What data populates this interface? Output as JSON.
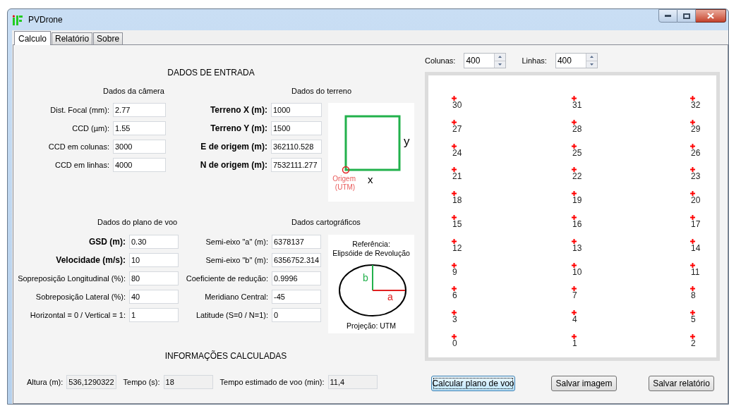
{
  "window": {
    "title": "PVDrone"
  },
  "tabs": [
    {
      "label": "Calculo",
      "selected": true
    },
    {
      "label": "Relatório",
      "selected": false
    },
    {
      "label": "Sobre",
      "selected": false
    }
  ],
  "input_section": {
    "heading": "DADOS DE ENTRADA",
    "camera": {
      "title": "Dados da câmera",
      "fields": [
        {
          "label": "Dist. Focal (mm):",
          "value": "2.77",
          "bold": false
        },
        {
          "label": "CCD (µm):",
          "value": "1.55",
          "bold": false
        },
        {
          "label": "CCD em colunas:",
          "value": "3000",
          "bold": false
        },
        {
          "label": "CCD em linhas:",
          "value": "4000",
          "bold": false
        }
      ]
    },
    "terrain": {
      "title": "Dados do terreno",
      "fields": [
        {
          "label": "Terreno X (m):",
          "value": "1000",
          "bold": true
        },
        {
          "label": "Terreno Y (m):",
          "value": "1500",
          "bold": true
        },
        {
          "label": "E de origem (m):",
          "value": "362110.528",
          "bold": true
        },
        {
          "label": "N de origem (m):",
          "value": "7532111.277",
          "bold": true
        }
      ]
    },
    "terrain_diagram": {
      "y_label": "y",
      "x_label": "x",
      "origin_label": "Origem (UTM)"
    },
    "flight_plan": {
      "title": "Dados do plano de voo",
      "fields": [
        {
          "label": "GSD (m):",
          "value": "0.30",
          "bold": true
        },
        {
          "label": "Velocidade (m/s):",
          "value": "10",
          "bold": true
        },
        {
          "label": "Sopreposição Longitudinal (%):",
          "value": "80",
          "bold": false
        },
        {
          "label": "Sobreposição Lateral (%):",
          "value": "40",
          "bold": false
        },
        {
          "label": "Horizontal = 0 / Vertical = 1:",
          "value": "1",
          "bold": false
        }
      ]
    },
    "cartographic": {
      "title": "Dados cartográficos",
      "fields": [
        {
          "label": "Semi-eixo \"a\" (m):",
          "value": "6378137",
          "bold": false
        },
        {
          "label": "Semi-eixo \"b\" (m):",
          "value": "6356752.314",
          "bold": false
        },
        {
          "label": "Coeficiente de redução:",
          "value": "0.9996",
          "bold": false
        },
        {
          "label": "Meridiano Central:",
          "value": "-45",
          "bold": false
        },
        {
          "label": "Latitude (S=0 / N=1):",
          "value": "0",
          "bold": false
        }
      ]
    },
    "ellipsoid_diagram": {
      "reference_lines": [
        "Referência:",
        "Elipsóide de Revolução"
      ],
      "b_label": "b",
      "a_label": "a",
      "caption": "Projeção: UTM"
    }
  },
  "calculated_section": {
    "heading": "INFORMAÇÕES CALCULADAS",
    "fields": [
      {
        "label": "Altura (m):",
        "value": "536,1290322"
      },
      {
        "label": "Tempo (s):",
        "value": "18"
      },
      {
        "label": "Tempo estimado de voo (min):",
        "value": "11,4"
      }
    ]
  },
  "grid": {
    "columns": {
      "label": "Colunas:",
      "value": "400"
    },
    "rows": {
      "label": "Linhas:",
      "value": "400"
    },
    "points": [
      "30",
      "31",
      "32",
      "27",
      "28",
      "29",
      "24",
      "25",
      "26",
      "21",
      "22",
      "23",
      "18",
      "19",
      "20",
      "15",
      "16",
      "17",
      "12",
      "13",
      "14",
      "9",
      "10",
      "11",
      "6",
      "7",
      "8",
      "3",
      "4",
      "5",
      "0",
      "1",
      "2"
    ]
  },
  "buttons": [
    {
      "label": "Calcular plano de voo",
      "focused": true
    },
    {
      "label": "Salvar imagem",
      "focused": false
    },
    {
      "label": "Salvar relatório",
      "focused": false
    }
  ]
}
